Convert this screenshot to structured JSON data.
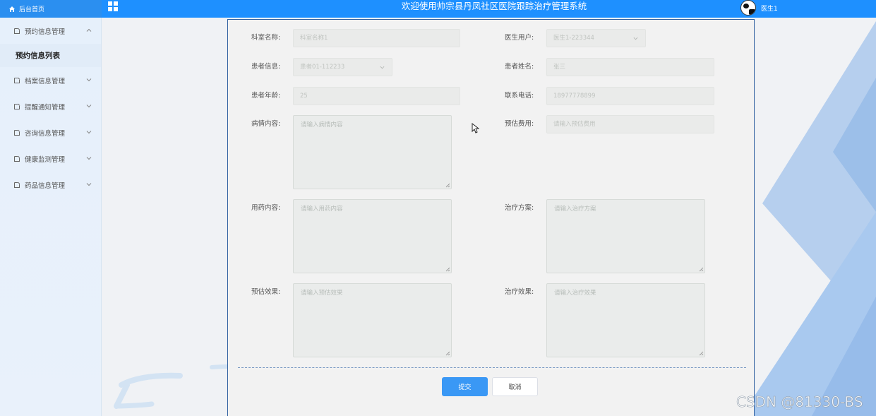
{
  "app": {
    "home_tab": "后台首页",
    "system_title": "欢迎使用帅宗县丹凤社区医院跟踪治疗管理系统",
    "user_name": "医生1"
  },
  "sidebar": {
    "items": [
      {
        "label": "预约信息管理",
        "expanded": true,
        "sub_items": [
          {
            "label": "预约信息列表"
          }
        ]
      },
      {
        "label": "档案信息管理",
        "expanded": false
      },
      {
        "label": "提醒通知管理",
        "expanded": false
      },
      {
        "label": "咨询信息管理",
        "expanded": false
      },
      {
        "label": "健康监测管理",
        "expanded": false
      },
      {
        "label": "药品信息管理",
        "expanded": false
      }
    ]
  },
  "form": {
    "department_name": {
      "label": "科室名称:",
      "value": "科室名称1"
    },
    "doctor_user": {
      "label": "医生用户:",
      "value": "医生1-223344"
    },
    "patient_info": {
      "label": "患者信息:",
      "value": "患者01-112233"
    },
    "patient_name": {
      "label": "患者姓名:",
      "value": "张三"
    },
    "patient_age": {
      "label": "患者年龄:",
      "value": "25"
    },
    "phone": {
      "label": "联系电话:",
      "value": "18977778899"
    },
    "condition": {
      "label": "病情内容:",
      "placeholder": "请输入病情内容"
    },
    "estimated_cost": {
      "label": "预估费用:",
      "placeholder": "请输入预估费用"
    },
    "medication": {
      "label": "用药内容:",
      "placeholder": "请输入用药内容"
    },
    "treatment_plan": {
      "label": "治疗方案:",
      "placeholder": "请输入治疗方案"
    },
    "expected_effect": {
      "label": "预估效果:",
      "placeholder": "请输入预估效果"
    },
    "treatment_effect": {
      "label": "治疗效果:",
      "placeholder": "请输入治疗效果"
    },
    "submit_label": "提交",
    "cancel_label": "取消"
  },
  "watermark": "CSDN @81330-BS",
  "colors": {
    "topbar": "#1e90ff",
    "primary_button": "#3a98f5",
    "sidebar_bg": "#e6f0fb",
    "panel_border": "#2f5fa0"
  },
  "icons": [
    "home-icon",
    "grid-menu-icon",
    "document-icon",
    "chevron-up-icon",
    "chevron-down-icon",
    "avatar",
    "mouse-cursor-icon"
  ]
}
